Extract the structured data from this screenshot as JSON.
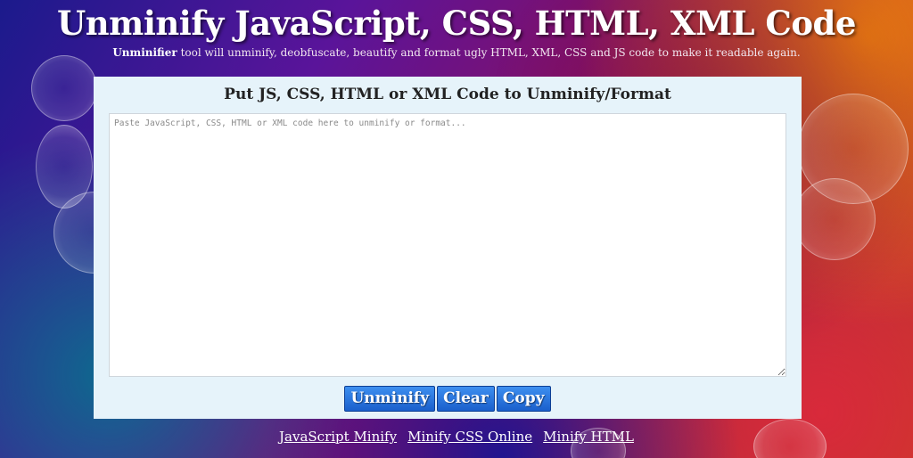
{
  "header": {
    "title": "Unminify JavaScript, CSS, HTML, XML Code",
    "subtitle_brand": "Unminifier",
    "subtitle_text": " tool will unminify, deobfuscate, beautify and format ugly HTML, XML, CSS and JS code to make it readable again."
  },
  "panel": {
    "title": "Put JS, CSS, HTML or XML Code to Unminify/Format",
    "editor": {
      "placeholder": "Paste JavaScript, CSS, HTML or XML code here to unminify or format...",
      "value": ""
    },
    "buttons": {
      "unminify": "Unminify",
      "clear": "Clear",
      "copy": "Copy"
    }
  },
  "footer_links": [
    {
      "label": "JavaScript Minify"
    },
    {
      "label": "Minify CSS Online"
    },
    {
      "label": "Minify HTML"
    }
  ],
  "colors": {
    "panel_bg": "#e6f3fa",
    "button_bg": "#1a5fcc"
  }
}
